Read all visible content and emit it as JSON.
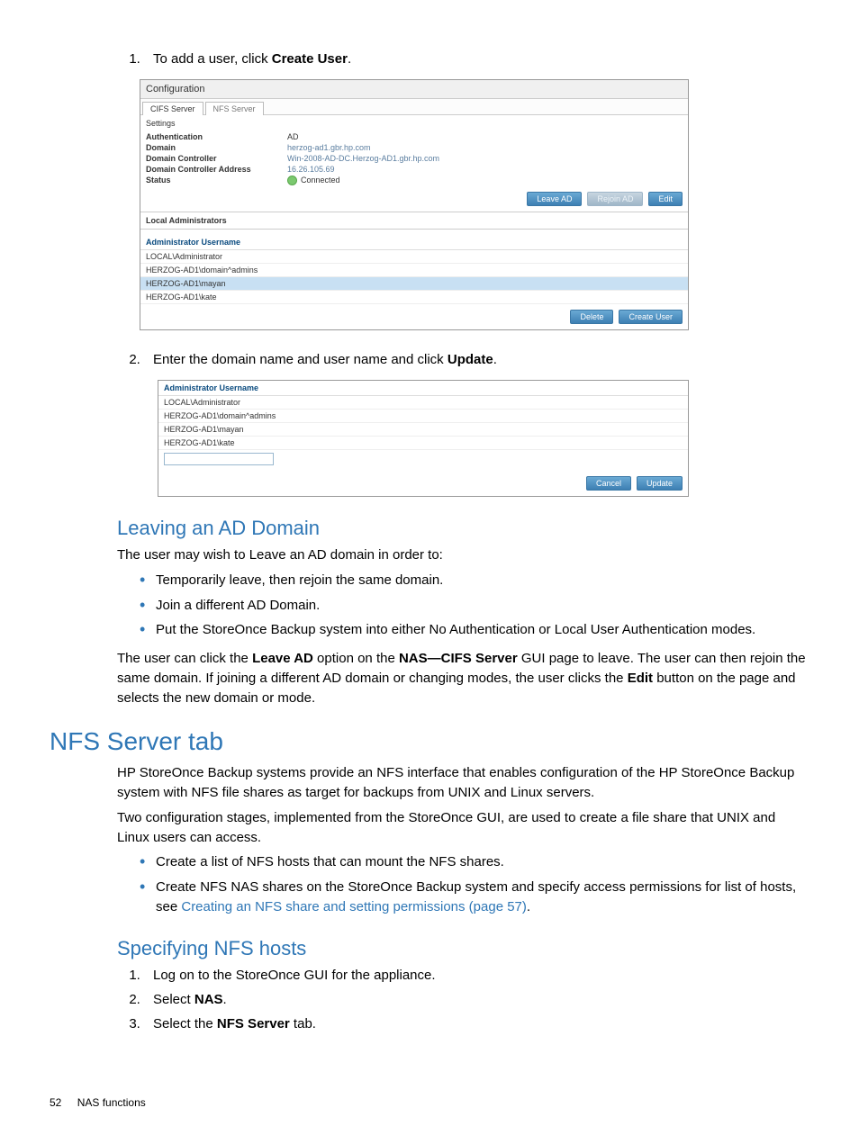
{
  "steps": {
    "s1_pre": "To add a user, click ",
    "s1_bold": "Create User",
    "s2_pre": "Enter the domain name and user name and click ",
    "s2_bold": "Update"
  },
  "ss1": {
    "title": "Configuration",
    "tabs": {
      "active": "CIFS Server",
      "inactive": "NFS Server"
    },
    "settings": "Settings",
    "rows": {
      "auth_k": "Authentication",
      "auth_v": "AD",
      "domain_k": "Domain",
      "domain_v": "herzog-ad1.gbr.hp.com",
      "dc_k": "Domain Controller",
      "dc_v": "Win-2008-AD-DC.Herzog-AD1.gbr.hp.com",
      "dca_k": "Domain Controller Address",
      "dca_v": "16.26.105.69",
      "status_k": "Status",
      "status_v": "Connected"
    },
    "buttons": {
      "leave": "Leave AD",
      "rejoin": "Rejoin AD",
      "edit": "Edit"
    },
    "local_admins": "Local Administrators",
    "admin_hdr": "Administrator Username",
    "admins": [
      "LOCAL\\Administrator",
      "HERZOG-AD1\\domain^admins",
      "HERZOG-AD1\\mayan",
      "HERZOG-AD1\\kate"
    ],
    "buttons2": {
      "delete": "Delete",
      "create": "Create User"
    }
  },
  "ss2": {
    "admin_hdr": "Administrator Username",
    "admins": [
      "LOCAL\\Administrator",
      "HERZOG-AD1\\domain^admins",
      "HERZOG-AD1\\mayan",
      "HERZOG-AD1\\kate"
    ],
    "buttons": {
      "cancel": "Cancel",
      "update": "Update"
    }
  },
  "leaving": {
    "title": "Leaving an AD Domain",
    "intro": "The user may wish to Leave an AD domain in order to:",
    "b1": "Temporarily leave, then rejoin the same domain.",
    "b2": "Join a different AD Domain.",
    "b3": "Put the StoreOnce Backup system into either No Authentication or Local User Authentication modes.",
    "para_1": "The user can click the ",
    "para_lead": "Leave AD",
    "para_2": " option on the ",
    "para_nas": "NAS—CIFS Server",
    "para_3": " GUI page to leave. The user can then rejoin the same domain. If joining a different AD domain or changing modes, the user clicks the ",
    "para_edit": "Edit",
    "para_4": " button on the page and selects the new domain or mode."
  },
  "nfs": {
    "title": "NFS Server tab",
    "p1": "HP StoreOnce Backup systems provide an NFS interface that enables configuration of the HP StoreOnce Backup system with NFS file shares as target for backups from UNIX and Linux servers.",
    "p2": "Two configuration stages, implemented from the StoreOnce GUI, are used to create a file share that UNIX and Linux users can access.",
    "b1": "Create a list of NFS hosts that can mount the NFS shares.",
    "b2a": "Create NFS NAS shares on the StoreOnce Backup system and specify access permissions for list of hosts, see ",
    "b2link": "Creating an NFS share and setting permissions (page 57)",
    "b2b": "."
  },
  "spec": {
    "title": "Specifying NFS hosts",
    "s1": "Log on to the StoreOnce GUI for the appliance.",
    "s2a": "Select ",
    "s2b": "NAS",
    "s2c": ".",
    "s3a": "Select the ",
    "s3b": "NFS Server",
    "s3c": " tab."
  },
  "footer": {
    "page": "52",
    "section": "NAS functions"
  }
}
